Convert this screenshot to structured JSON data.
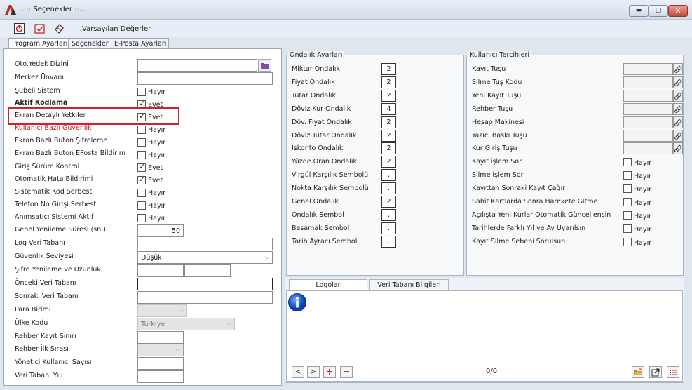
{
  "window": {
    "title": "...:: Seçenekler ::...",
    "minimize": "▬",
    "maximize": "▢",
    "close": "✕"
  },
  "toolbar": {
    "default_values_label": "Varsayılan Değerler"
  },
  "tabs": [
    "Program Ayarları",
    "Seçenekler",
    "E-Posta Ayarları"
  ],
  "left": {
    "oto_yedek_dizini": "Oto.Yedek Dizini",
    "merkez_unvani": "Merkez Ünvanı",
    "subeli_sistem": "Şubeli Sistem",
    "aktif_kodlama": "Aktif Kodlama",
    "ekran_detayli_yetkiler": "Ekran Detaylı Yetkiler",
    "kullanici_bazli_guvenlik": "Kullanıcı Bazlı Güvenlik",
    "ekran_bazli_buton_sifreleme": "Ekran Bazlı Buton Şifreleme",
    "ekran_bazli_buton_eposta": "Ekran Bazlı Buton EPosta Bildirim",
    "giris_surum_kontrol": "Giriş Sürüm Kontrol",
    "otomatik_hata_bildirimi": "Otomatik Hata Bildirimi",
    "sistematik_kod_serbest": "Sistematik Kod Serbest",
    "telefon_no_girisi": "Telefon No Girişi Serbest",
    "animsatici_sistemi": "Anımsatıcı Sistemi Aktif",
    "genel_yenileme_suresi": "Genel Yenileme Süresi (sn.)",
    "genel_yenileme_value": "50",
    "log_veri_tabani": "Log Veri Tabanı",
    "guvenlik_seviyesi": "Güvenlik Seviyesi",
    "guvenlik_seviyesi_value": "Düşük",
    "sifre_yenileme": "Şifre Yenileme ve Uzunluk",
    "onceki_veri_tabani": "Önceki Veri Tabanı",
    "sonraki_veri_tabani": "Sonraki Veri Tabanı",
    "para_birimi": "Para Birimi",
    "ulke_kodu": "Ülke Kodu",
    "ulke_kodu_value": "Türkiye",
    "rehber_kayit_siniri": "Rehber Kayıt Sınırı",
    "rehber_ilk_sirasi": "Rehber İlk Sırası",
    "yonetici_kullanici_sayisi": "Yönetici Kullanıcı Sayısı",
    "veri_tabani_yili": "Veri Tabanı Yılı",
    "hayir": "Hayır",
    "evet": "Evet"
  },
  "ondalik": {
    "title": "Ondalık Ayarları",
    "rows": [
      {
        "label": "Miktar Ondalık",
        "value": "2"
      },
      {
        "label": "Fiyat Ondalık",
        "value": "2"
      },
      {
        "label": "Tutar Ondalık",
        "value": "2"
      },
      {
        "label": "Döviz Kur Ondalık",
        "value": "4"
      },
      {
        "label": "Döv. Fiyat Ondalık",
        "value": "2"
      },
      {
        "label": "Döviz Tutar Ondalık",
        "value": "2"
      },
      {
        "label": "İskonto Ondalık",
        "value": "2"
      },
      {
        "label": "Yüzde Oran Ondalık",
        "value": "2"
      },
      {
        "label": "Virgül Karşılık Sembolü",
        "value": ","
      },
      {
        "label": "Nokta Karşılık Sembolü",
        "value": "."
      },
      {
        "label": "Genel Ondalık",
        "value": "2"
      },
      {
        "label": "Ondalık Sembol",
        "value": ","
      },
      {
        "label": "Basamak Sembol",
        "value": "."
      },
      {
        "label": "Tarih Ayracı Sembol",
        "value": "."
      }
    ]
  },
  "kullanici": {
    "title": "Kullanıcı Tercihleri",
    "keys": [
      "Kayıt Tuşu",
      "Silme Tuş Kodu",
      "Yeni Kayıt Tuşu",
      "Rehber Tuşu",
      "Hesap Makinesi",
      "Yazıcı Baskı Tuşu",
      "Kur Giriş Tuşu"
    ],
    "checks": [
      "Kayıt işlem Sor",
      "Silme işlem Sor",
      "Kayıttan Sonraki Kayıt Çağır",
      "Sabit Kartlarda Sonra Harekete Gitme",
      "Açılışta Yeni Kurlar Otomatik Güncellensin",
      "Tarihlerde Farklı Yıl ve Ay Uyarılsın",
      "Kayıt Silme Sebebi Sorulsun"
    ],
    "hayir": "Hayır"
  },
  "bottom": {
    "tabs": [
      "Logolar",
      "Veri Tabanı Bilgileri"
    ],
    "counter": "0/0",
    "nav": [
      "<",
      ">",
      "+",
      "−"
    ]
  }
}
